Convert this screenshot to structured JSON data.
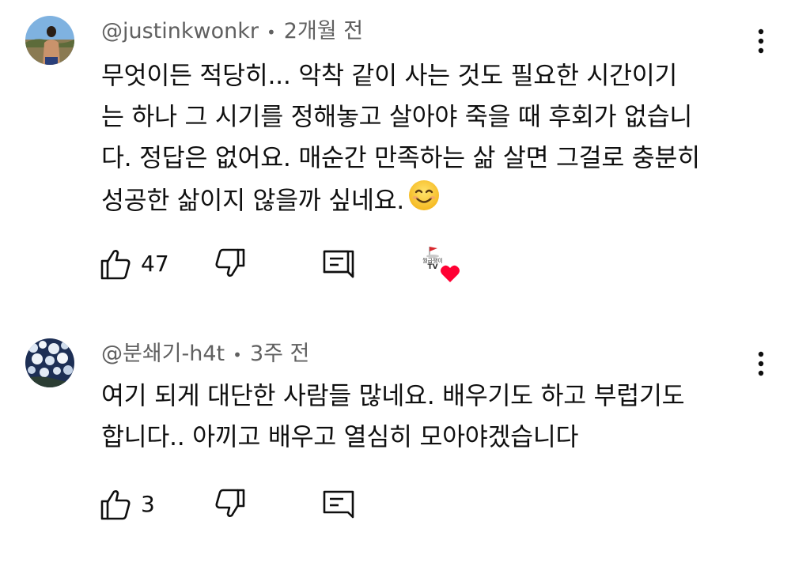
{
  "comments": [
    {
      "author": "@justinkwonkr",
      "time": "2개월 전",
      "text_lines": [
        "무엇이든 적당히... 악착 같이 사는 것도 필요한 시간이기",
        "는 하나 그 시기를 정해놓고 살아야 죽을 때 후회가 없습니",
        "다. 정답은 없어요. 매순간 만족하는 삶 살면 그걸로 충분히",
        "성공한 삶이지 않을까 싶네요."
      ],
      "emoji": "smiling-face-icon",
      "likes": "47",
      "creator_heart": {
        "channel_label_line1": "월급쟁이",
        "channel_label_line2": "TV",
        "heart_color": "#ff0033"
      }
    },
    {
      "author": "@분쇄기-h4t",
      "time": "3주 전",
      "text_lines": [
        "여기 되게 대단한 사람들 많네요. 배우기도 하고 부럽기도",
        "합니다.. 아끼고 배우고 열심히 모아야겠습니다"
      ],
      "likes": "3"
    }
  ],
  "separator": "•",
  "icons": {
    "like": "thumb-up-icon",
    "dislike": "thumb-down-icon",
    "reply": "comment-icon",
    "more": "vertical-dots-icon"
  },
  "colors": {
    "text": "#0f0f0f",
    "meta": "#606060",
    "heart": "#ff0033"
  }
}
